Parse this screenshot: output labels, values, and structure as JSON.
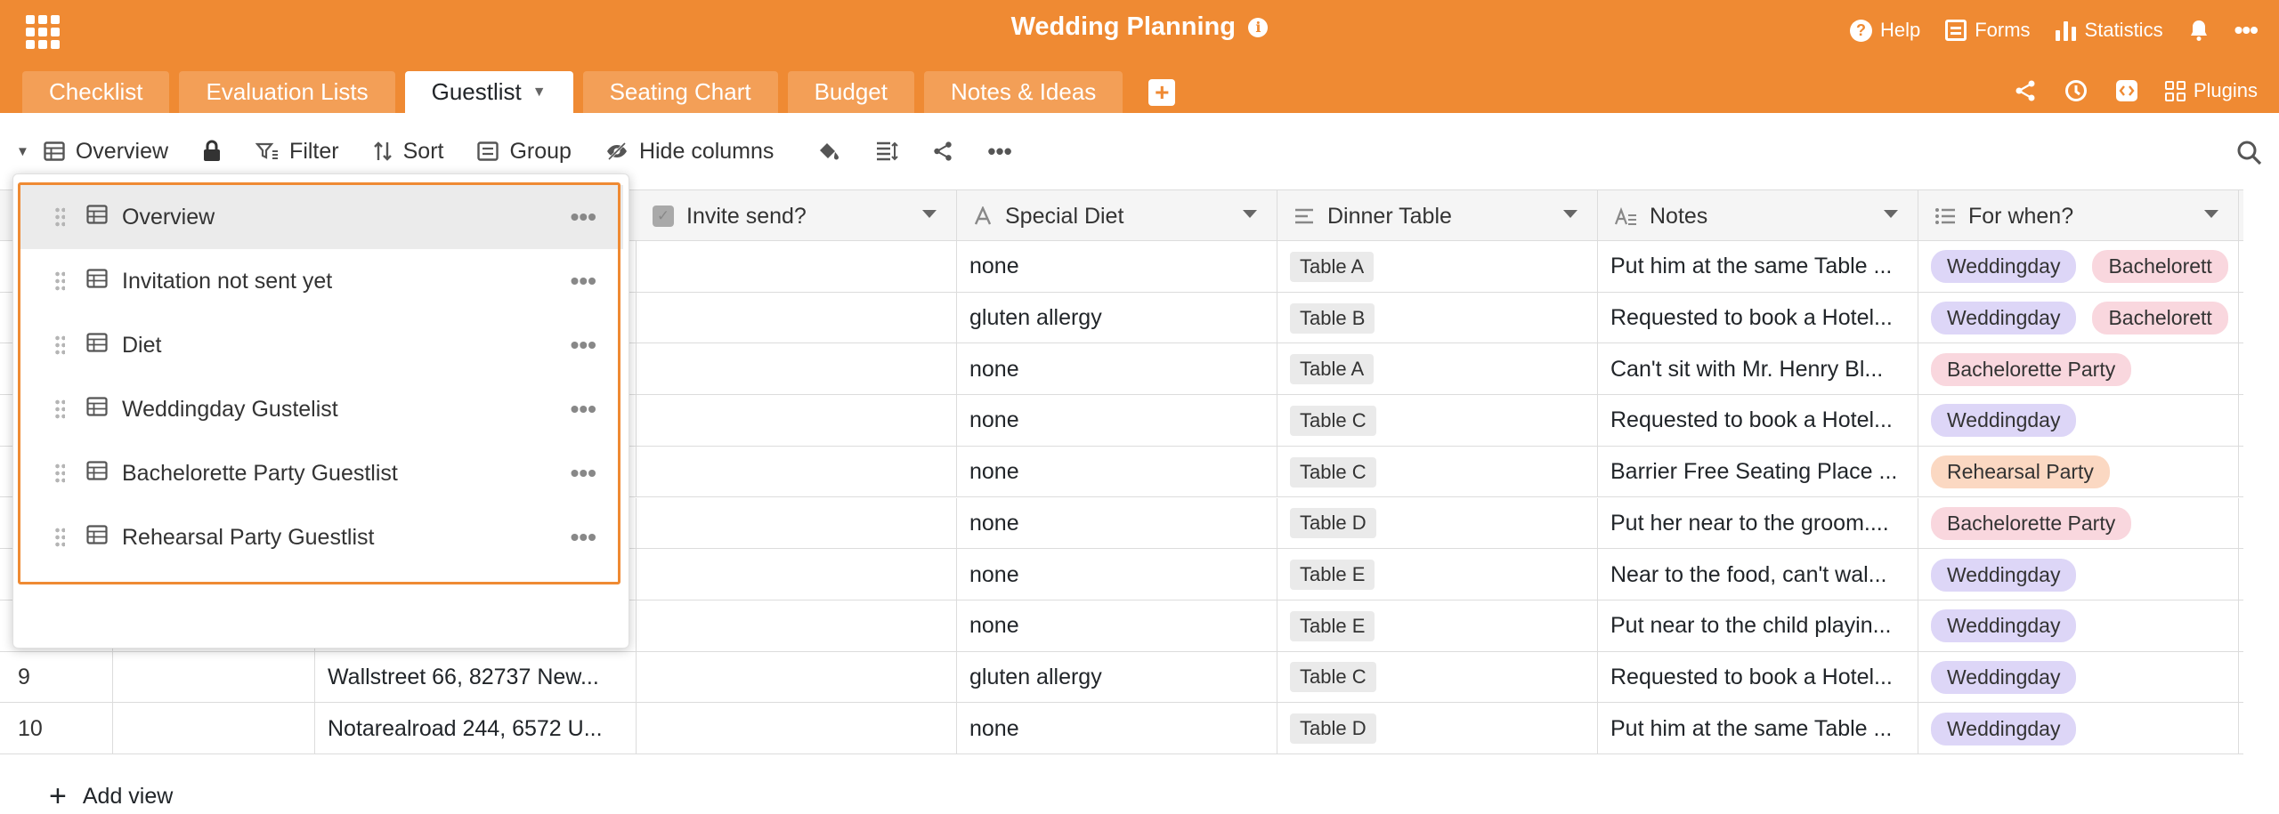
{
  "app": {
    "title": "Wedding Planning",
    "brand_color": "#ef8a33"
  },
  "top_actions": {
    "help": "Help",
    "forms": "Forms",
    "statistics": "Statistics"
  },
  "tabs": [
    {
      "label": "Checklist"
    },
    {
      "label": "Evaluation Lists"
    },
    {
      "label": "Guestlist",
      "active": true
    },
    {
      "label": "Seating Chart"
    },
    {
      "label": "Budget"
    },
    {
      "label": "Notes & Ideas"
    }
  ],
  "tab_right": {
    "plugins": "Plugins"
  },
  "toolbar": {
    "view_name": "Overview",
    "filter": "Filter",
    "sort": "Sort",
    "group": "Group",
    "hide_columns": "Hide columns"
  },
  "columns": {
    "invite_send": "Invite send?",
    "special_diet": "Special Diet",
    "dinner_table": "Dinner Table",
    "notes": "Notes",
    "for_when": "For when?"
  },
  "event_colors": {
    "Weddingday": "#ddd6f7",
    "Bachelorette Party": "#f9d7de",
    "Rehearsal Party": "#fbd8c2"
  },
  "rows": [
    {
      "num": "",
      "address": "",
      "diet": "none",
      "table": "Table A",
      "notes": "Put him at the same Table ...",
      "events": [
        "Weddingday",
        "Bachelorett"
      ]
    },
    {
      "num": "",
      "address": "",
      "diet": "gluten allergy",
      "table": "Table B",
      "notes": "Requested to book a Hotel...",
      "events": [
        "Weddingday",
        "Bachelorett"
      ]
    },
    {
      "num": "",
      "address": "",
      "diet": "none",
      "table": "Table A",
      "notes": "Can't sit with Mr. Henry Bl...",
      "events": [
        "Bachelorette Party"
      ]
    },
    {
      "num": "",
      "address": "",
      "diet": "none",
      "table": "Table C",
      "notes": "Requested to book a Hotel...",
      "events": [
        "Weddingday"
      ]
    },
    {
      "num": "",
      "address": "",
      "diet": "none",
      "table": "Table C",
      "notes": "Barrier Free Seating Place ...",
      "events": [
        "Rehearsal Party"
      ]
    },
    {
      "num": "",
      "address": "",
      "diet": "none",
      "table": "Table D",
      "notes": "Put her near to the groom....",
      "events": [
        "Bachelorette Party"
      ]
    },
    {
      "num": "",
      "address": "",
      "diet": "none",
      "table": "Table E",
      "notes": "Near to the food, can't wal...",
      "events": [
        "Weddingday"
      ]
    },
    {
      "num": "",
      "address": "",
      "diet": "none",
      "table": "Table E",
      "notes": "Put near to the child playin...",
      "events": [
        "Weddingday"
      ]
    },
    {
      "num": "9",
      "address": "Wallstreet 66, 82737 New...",
      "diet": "gluten allergy",
      "table": "Table C",
      "notes": "Requested to book a Hotel...",
      "events": [
        "Weddingday"
      ]
    },
    {
      "num": "10",
      "address": "Notarealroad 244, 6572 U...",
      "diet": "none",
      "table": "Table D",
      "notes": "Put him at the same Table ...",
      "events": [
        "Weddingday"
      ]
    }
  ],
  "views_menu": {
    "items": [
      {
        "label": "Overview",
        "active": true
      },
      {
        "label": "Invitation not sent yet"
      },
      {
        "label": "Diet"
      },
      {
        "label": "Weddingday Gustelist"
      },
      {
        "label": "Bachelorette Party Guestlist"
      },
      {
        "label": "Rehearsal Party Guestlist"
      }
    ],
    "add_view": "Add view"
  }
}
